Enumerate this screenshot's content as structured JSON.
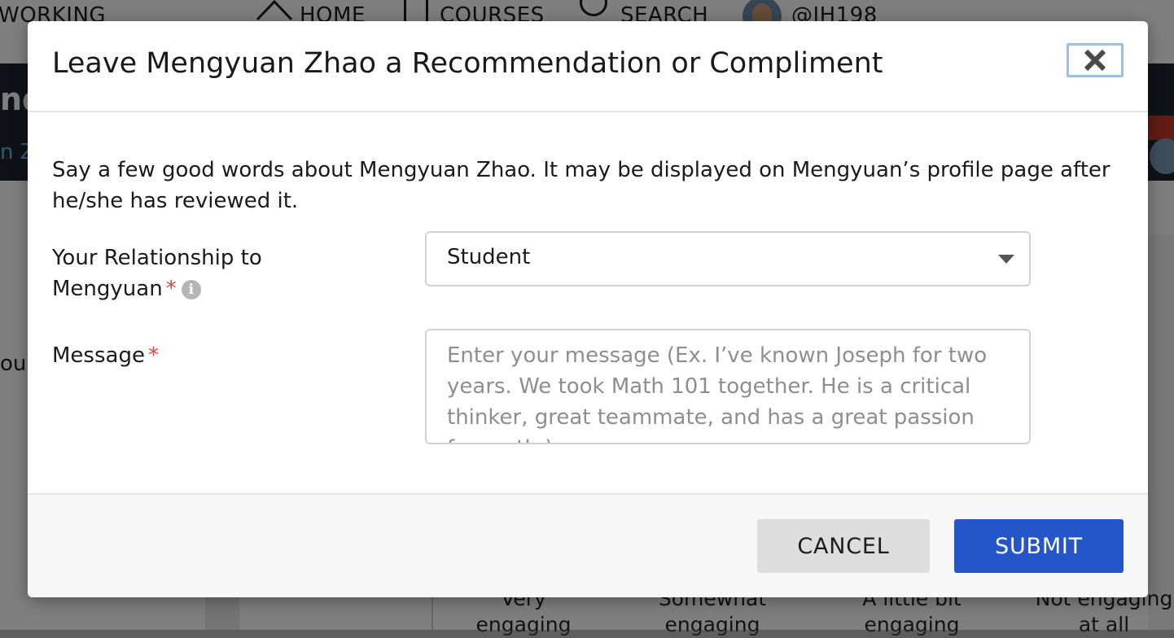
{
  "background": {
    "nav": {
      "brand_fragment": "WORKING",
      "home": "HOME",
      "courses": "COURSES",
      "search": "SEARCH",
      "username": "@JH198"
    },
    "banner_fragment_1": "nd",
    "banner_fragment_2": "n Z",
    "content_fragment": "ou",
    "rating_columns": [
      "Very engaging",
      "Somewhat engaging",
      "A little bit engaging",
      "Not engaging at all"
    ]
  },
  "modal": {
    "title": "Leave Mengyuan Zhao a Recommendation or Compliment",
    "close_icon": "close-x-icon",
    "intro": "Say a few good words about Mengyuan Zhao. It may be displayed on Mengyuan’s profile page after he/she has reviewed it.",
    "relationship": {
      "label": "Your Relationship to Mengyuan",
      "required_mark": "*",
      "selected": "Student"
    },
    "message": {
      "label": "Message",
      "required_mark": "*",
      "placeholder": "Enter your message (Ex. I’ve known Joseph for two years. We took Math 101 together. He is a critical thinker, great teammate, and has a great passion for math.)"
    },
    "buttons": {
      "cancel": "CANCEL",
      "submit": "SUBMIT"
    }
  },
  "colors": {
    "primary_button": "#2456c9",
    "required_asterisk": "#e0433a",
    "close_focus_ring": "#9bc0e6"
  }
}
